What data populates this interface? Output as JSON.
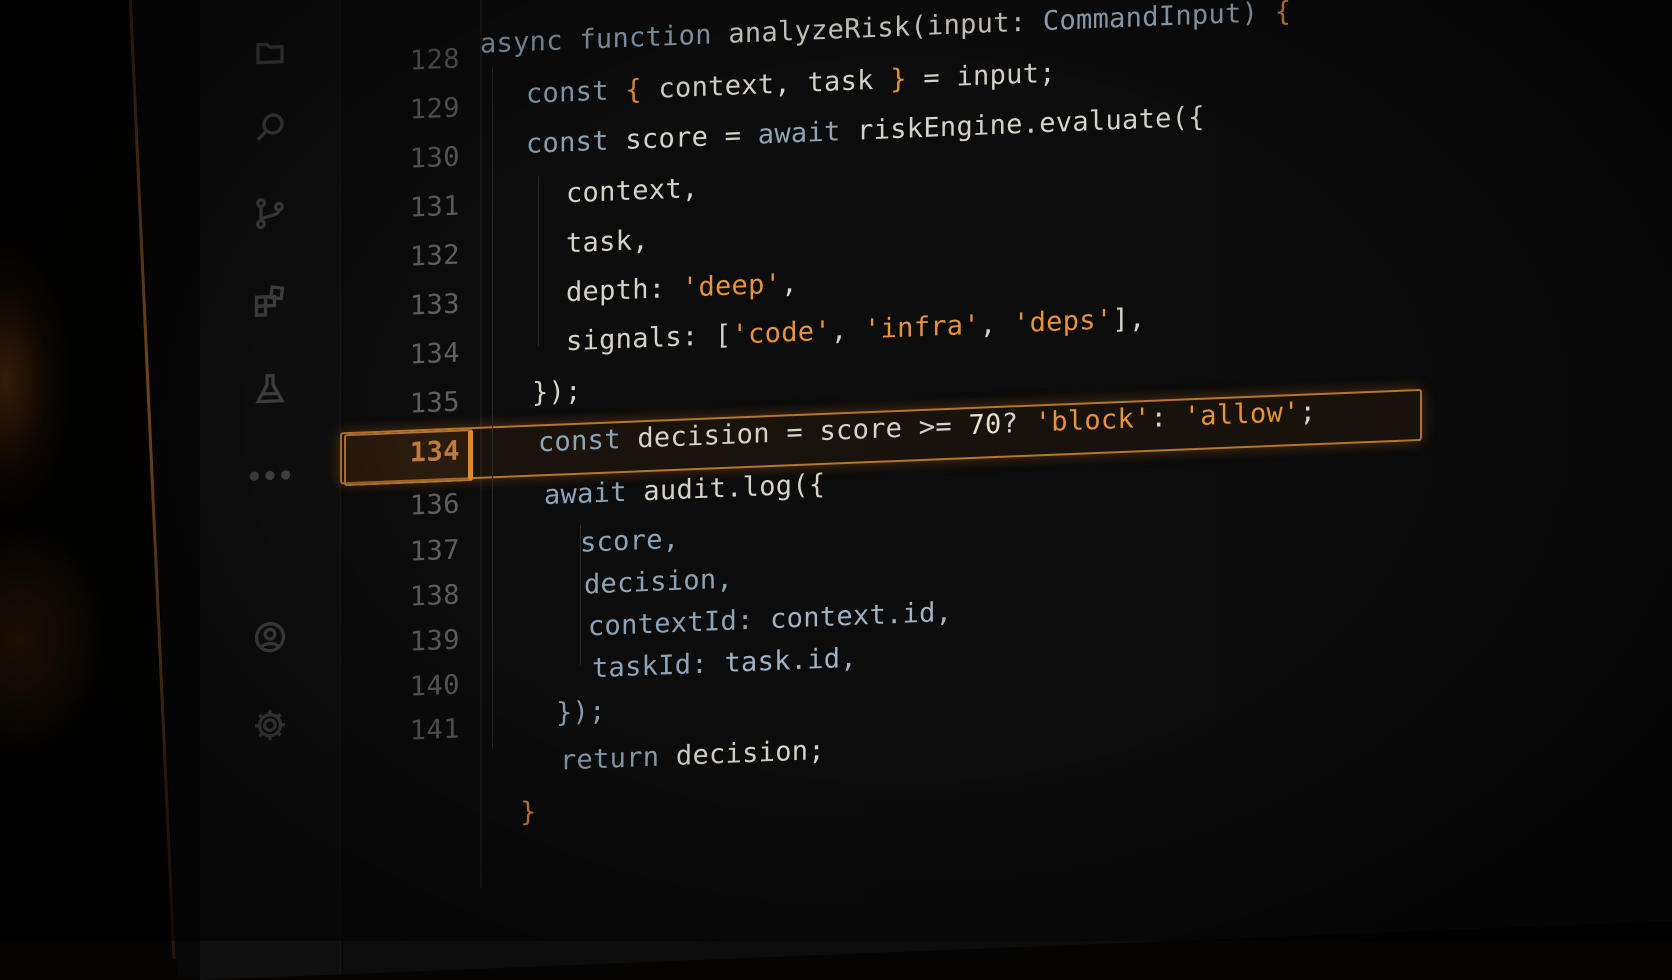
{
  "activity_bar": {
    "icons": [
      "explorer-icon",
      "search-icon",
      "source-control-icon",
      "extensions-icon",
      "testing-icon",
      "more-icon",
      "account-icon",
      "settings-gear-icon"
    ],
    "more_label": "•••"
  },
  "editor": {
    "accent_color": "#e8923a",
    "highlighted_line_number": "134",
    "line_numbers": [
      "128",
      "129",
      "130",
      "131",
      "132",
      "133",
      "134",
      "135",
      "134",
      "136",
      "137",
      "138",
      "139",
      "140",
      "141"
    ],
    "lines": [
      {
        "parts": [
          {
            "t": "async function ",
            "c": "kw"
          },
          {
            "t": "analyzeRisk(input: ",
            "c": "fn"
          },
          {
            "t": "CommandInput) ",
            "c": "typ"
          },
          {
            "t": "{",
            "c": "brace"
          }
        ]
      },
      {
        "parts": [
          {
            "t": "  const ",
            "c": "kw"
          },
          {
            "t": "{ ",
            "c": "brace"
          },
          {
            "t": "context, task ",
            "c": "fn"
          },
          {
            "t": "} ",
            "c": "brace"
          },
          {
            "t": "= input;",
            "c": "fn"
          }
        ]
      },
      {
        "parts": [
          {
            "t": "  const ",
            "c": "kw"
          },
          {
            "t": "score = ",
            "c": "fn"
          },
          {
            "t": "await ",
            "c": "kw"
          },
          {
            "t": "riskEngine.evaluate({",
            "c": "fn"
          }
        ]
      },
      {
        "parts": [
          {
            "t": "    context,",
            "c": "fn"
          }
        ]
      },
      {
        "parts": [
          {
            "t": "    task,",
            "c": "fn"
          }
        ]
      },
      {
        "parts": [
          {
            "t": "    depth: ",
            "c": "fn"
          },
          {
            "t": "'deep'",
            "c": "str"
          },
          {
            "t": ",",
            "c": "fn"
          }
        ]
      },
      {
        "parts": [
          {
            "t": "    signals: [",
            "c": "fn"
          },
          {
            "t": "'code'",
            "c": "str"
          },
          {
            "t": ", ",
            "c": "fn"
          },
          {
            "t": "'infra'",
            "c": "str"
          },
          {
            "t": ", ",
            "c": "fn"
          },
          {
            "t": "'deps'",
            "c": "str"
          },
          {
            "t": "],",
            "c": "fn"
          }
        ]
      },
      {
        "parts": [
          {
            "t": "  });",
            "c": "fn"
          }
        ]
      },
      {
        "parts": [
          {
            "t": "  const ",
            "c": "kw"
          },
          {
            "t": "decision = score >= ",
            "c": "fn"
          },
          {
            "t": "70",
            "c": "num"
          },
          {
            "t": " ? ",
            "c": "fn"
          },
          {
            "t": "'block'",
            "c": "str"
          },
          {
            "t": " : ",
            "c": "fn"
          },
          {
            "t": "'allow'",
            "c": "str"
          },
          {
            "t": ";",
            "c": "fn"
          }
        ]
      },
      {
        "parts": [
          {
            "t": "  await ",
            "c": "kw"
          },
          {
            "t": "audit.log({",
            "c": "fn"
          }
        ]
      },
      {
        "parts": [
          {
            "t": "    score,",
            "c": "kw"
          }
        ]
      },
      {
        "parts": [
          {
            "t": "    decision,",
            "c": "kw"
          }
        ]
      },
      {
        "parts": [
          {
            "t": "    contextId: ",
            "c": "kw"
          },
          {
            "t": "context.id,",
            "c": "typ"
          }
        ]
      },
      {
        "parts": [
          {
            "t": "    taskId: ",
            "c": "kw"
          },
          {
            "t": "task.id,",
            "c": "typ"
          }
        ]
      },
      {
        "parts": [
          {
            "t": "  });",
            "c": "kw"
          }
        ]
      },
      {
        "parts": [
          {
            "t": "  return ",
            "c": "kw"
          },
          {
            "t": "decision;",
            "c": "fn"
          }
        ]
      },
      {
        "parts": [
          {
            "t": "}",
            "c": "brace"
          }
        ]
      }
    ]
  }
}
